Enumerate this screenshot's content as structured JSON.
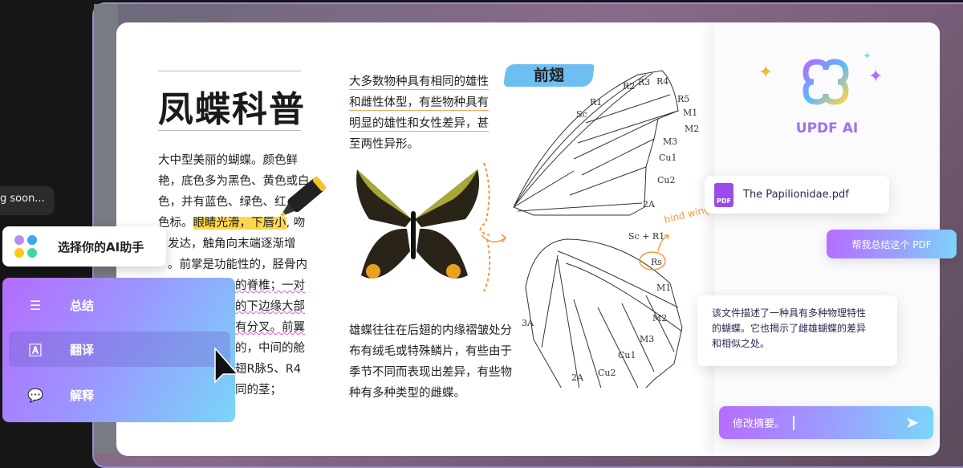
{
  "overlay": {
    "bubble_text": "g soon...",
    "helper_title": "选择你的AI助手",
    "menu": [
      {
        "icon": "list-icon",
        "label": "总结"
      },
      {
        "icon": "translate-icon",
        "label": "翻译"
      },
      {
        "icon": "chat-quote-icon",
        "label": "解释"
      }
    ]
  },
  "document": {
    "title": "凤蝶科普",
    "col1": [
      "大中型美丽的蝴蝶。颜色鲜",
      "艳，底色多为黑色、黄色或白",
      "色，并有蓝色、绿色、红",
      "色标。",
      "眼睛光滑，下唇小",
      ", 吻",
      "发达，触角向末端逐渐增",
      "。前掌是功能性的，胫骨内",
      "的脊椎；一对",
      "的下边缘大部",
      "有分叉。前翼",
      "的，中间的舱",
      "翅R脉5、R4",
      "同的茎；"
    ],
    "col2_top": [
      "大多数物种具有相同的雄性",
      "和雌性体型，有些物种具有",
      "明显的雄性和女性差异，甚",
      "至两性异形。"
    ],
    "col2_bottom": [
      "雄蝶往往在后翅的内缘褶皱处分",
      "布有绒毛或特殊鳞片，有些由于",
      "季节不同而表现出差异，有些物",
      "种有多种类型的雌蝶。"
    ],
    "diagram_title": "前翅",
    "fore_labels": [
      "Sc",
      "R1",
      "R2",
      "R3",
      "R4",
      "R5",
      "M1",
      "M2",
      "M3",
      "Cu1",
      "Cu2",
      "2A"
    ],
    "hind_labels": [
      "Sc + R1",
      "Rs",
      "M1",
      "M2",
      "M3",
      "Cu1",
      "Cu2",
      "2A",
      "3A"
    ],
    "annotation": "hind wing"
  },
  "ai": {
    "brand": "UPDF AI",
    "file_name": "The Papilionidae.pdf",
    "file_badge": "PDF",
    "user_message": "帮我总结这个 PDF",
    "reply": [
      "该文件描述了一种具有多种物理特性",
      "的蝴蝶。它也揭示了雌雄蝴蝶的差异",
      "和相似之处。"
    ],
    "input_value": "修改摘要。"
  },
  "colors": {
    "accent_purple": "#b46cff",
    "accent_blue": "#78d6f8",
    "highlight": "#ffd54a",
    "annotation_orange": "#f59a3a"
  }
}
